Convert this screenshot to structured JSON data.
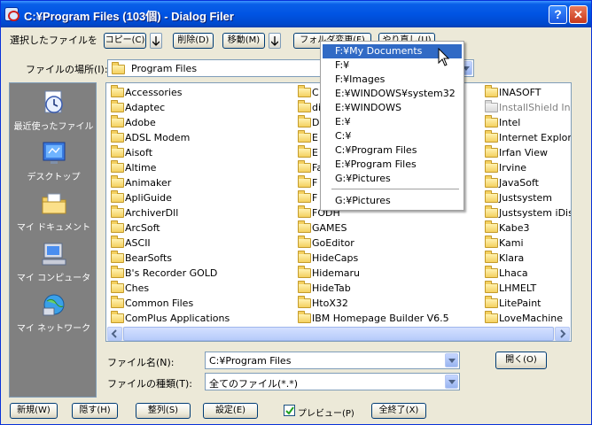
{
  "window": {
    "title": "C:¥Program Files (103個) - Dialog Filer",
    "help_glyph": "?",
    "close_glyph": "✕"
  },
  "toolbar": {
    "label": "選択したファイルを",
    "copy": "コピー(C)",
    "delete": "削除(D)",
    "move": "移動(M)",
    "change_folder": "フォルダ変更(F)",
    "reload": "やり直し(U)"
  },
  "location": {
    "label": "ファイルの場所(I):",
    "value": "Program Files"
  },
  "places": [
    {
      "label": "最近使ったファイル",
      "icon": "recent-files-icon"
    },
    {
      "label": "デスクトップ",
      "icon": "desktop-icon"
    },
    {
      "label": "マイ ドキュメント",
      "icon": "my-documents-icon"
    },
    {
      "label": "マイ コンピュータ",
      "icon": "my-computer-icon"
    },
    {
      "label": "マイ ネットワーク",
      "icon": "my-network-icon"
    }
  ],
  "files": {
    "col1": [
      "Accessories",
      "Adaptec",
      "Adobe",
      "ADSL Modem",
      "Aisoft",
      "Altime",
      "Animaker",
      "ApliGuide",
      "ArchiverDll",
      "ArcSoft",
      "ASCII",
      "BearSofts",
      "B's Recorder GOLD",
      "Ches",
      "Common Files",
      "ComPlus Applications"
    ],
    "col2": [
      "C",
      "di",
      "D",
      "E",
      "E",
      "Fa",
      "F",
      "F",
      "FODH",
      "GAMES",
      "GoEditor",
      "HideCaps",
      "Hidemaru",
      "HideTab",
      "HtoX32",
      "IBM Homepage Builder V6.5"
    ],
    "col3": [
      "INASOFT",
      "InstallShield Ins",
      "Intel",
      "Internet Explore",
      "Irfan View",
      "Irvine",
      "JavaSoft",
      "Justsystem",
      "Justsystem iDis",
      "Kabe3",
      "Kami",
      "Klara",
      "Lhaca",
      "LHMELT",
      "LitePaint",
      "LoveMachine"
    ]
  },
  "filename": {
    "label": "ファイル名(N):",
    "value": "C:¥Program Files"
  },
  "filetype": {
    "label": "ファイルの種類(T):",
    "value": "全てのファイル(*.*)"
  },
  "open_button": "開く(O)",
  "bottom": {
    "new": "新規(W)",
    "hide": "隠す(H)",
    "sort": "整列(S)",
    "settings": "設定(E)",
    "preview": "プレビュー(P)",
    "preview_checked": true,
    "quit_all": "全終了(X)"
  },
  "menu": {
    "items": [
      "F:¥My Documents",
      "F:¥",
      "F:¥Images",
      "E:¥WINDOWS¥system32",
      "E:¥WINDOWS",
      "E:¥",
      "C:¥",
      "C:¥Program Files",
      "E:¥Program Files",
      "G:¥Pictures"
    ],
    "highlighted": 0,
    "after_separator": "G:¥Pictures"
  },
  "colors": {
    "titlebar": "#0054e3",
    "highlight": "#316ac5",
    "dialog_bg": "#ece9d8",
    "places_bg": "#808080"
  }
}
